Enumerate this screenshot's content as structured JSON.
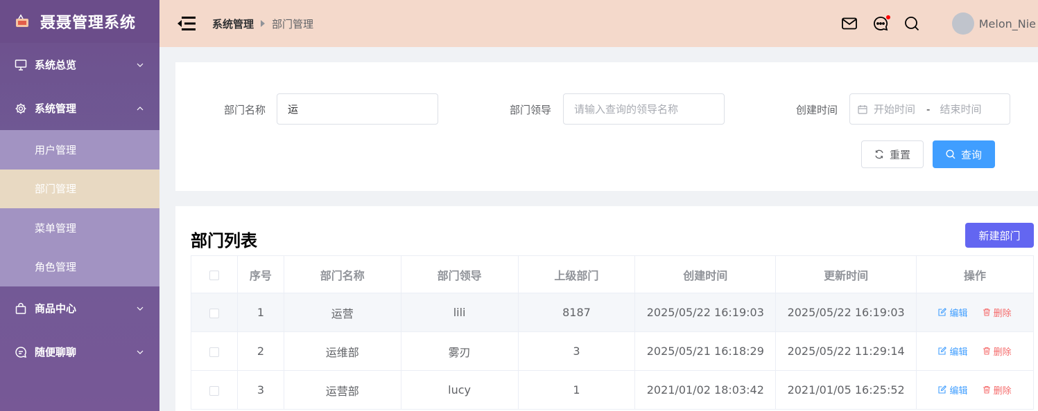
{
  "app": {
    "title": "聂聂管理系统"
  },
  "sidebar": {
    "menus": [
      {
        "label": "系统总览",
        "icon": "monitor-icon"
      },
      {
        "label": "系统管理",
        "icon": "gear-icon"
      },
      {
        "label": "商品中心",
        "icon": "shopping-bag-icon"
      },
      {
        "label": "随便聊聊",
        "icon": "chat-icon"
      }
    ],
    "sub_items": [
      {
        "label": "用户管理"
      },
      {
        "label": "部门管理"
      },
      {
        "label": "菜单管理"
      },
      {
        "label": "角色管理"
      }
    ]
  },
  "header": {
    "breadcrumb": [
      "系统管理",
      "部门管理"
    ],
    "username": "Melon_Nie"
  },
  "search": {
    "dept_name_label": "部门名称",
    "dept_name_value": "运",
    "leader_label": "部门领导",
    "leader_placeholder": "请输入查询的领导名称",
    "created_label": "创建时间",
    "start_placeholder": "开始时间",
    "range_separator": "-",
    "end_placeholder": "结束时间",
    "reset_label": "重置",
    "query_label": "查询"
  },
  "list": {
    "title": "部门列表",
    "new_label": "新建部门",
    "columns": [
      "序号",
      "部门名称",
      "部门领导",
      "上级部门",
      "创建时间",
      "更新时间",
      "操作"
    ],
    "rows": [
      {
        "index": "1",
        "name": "运营",
        "leader": "lili",
        "parent": "8187",
        "created": "2025/05/22 16:19:03",
        "updated": "2025/05/22 16:19:03"
      },
      {
        "index": "2",
        "name": "运维部",
        "leader": "雾刃",
        "parent": "3",
        "created": "2025/05/21 16:18:29",
        "updated": "2025/05/22 11:29:14"
      },
      {
        "index": "3",
        "name": "运营部",
        "leader": "lucy",
        "parent": "1",
        "created": "2021/01/02 18:03:42",
        "updated": "2021/01/05 16:25:52"
      }
    ],
    "edit_label": "编辑",
    "delete_label": "删除"
  },
  "colors": {
    "sidebar": "#6e4f8c",
    "header": "#f4d9cb",
    "primary": "#409eff",
    "new_button": "#6366f1",
    "danger": "#f56c6c"
  }
}
